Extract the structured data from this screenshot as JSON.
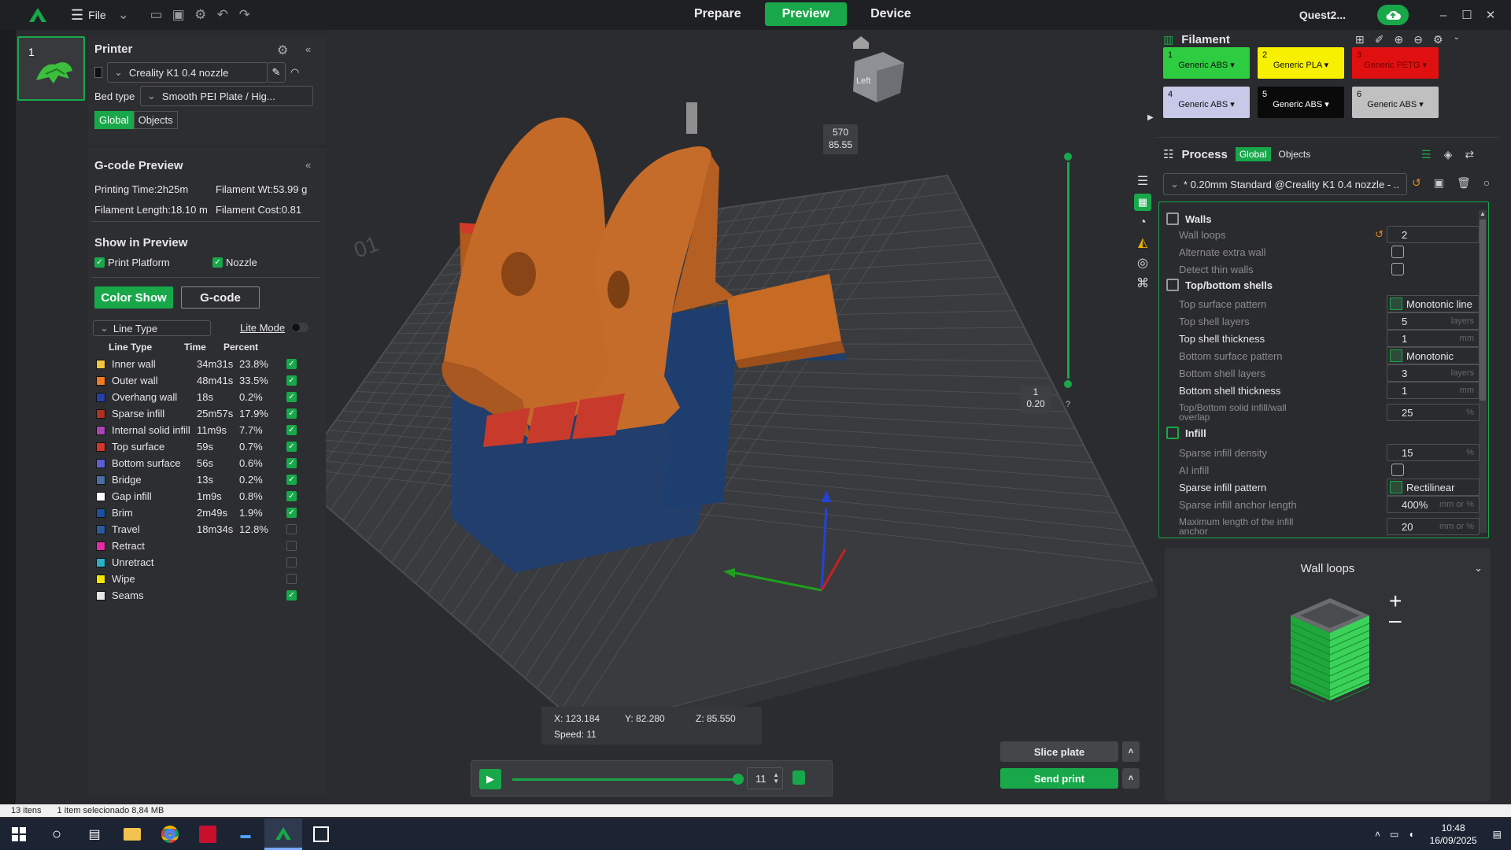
{
  "titlebar": {
    "file_label": "File",
    "tabs": [
      "Prepare",
      "Preview",
      "Device"
    ],
    "printer_name": "Quest2...",
    "accent": "#18a84a"
  },
  "thumbnail": {
    "plate_number": "1"
  },
  "printer": {
    "title": "Printer",
    "printer_select": "Creality K1 0.4 nozzle",
    "bed_type_label": "Bed type",
    "bed_type_select": "Smooth PEI Plate / Hig...",
    "seg_global": "Global",
    "seg_objects": "Objects"
  },
  "gcode_preview": {
    "title": "G-code Preview",
    "printing_time": "Printing Time:2h25m",
    "filament_wt": "Filament Wt:53.99 g",
    "filament_length": "Filament Length:18.10 m",
    "filament_cost": "Filament Cost:0.81",
    "show_title": "Show in Preview",
    "print_platform": "Print Platform",
    "nozzle": "Nozzle",
    "color_show": "Color Show",
    "gcode_btn": "G-code",
    "line_type_select": "Line Type",
    "lite_mode": "Lite Mode",
    "headers": {
      "type": "Line Type",
      "time": "Time",
      "percent": "Percent"
    },
    "rows": [
      {
        "name": "Inner wall",
        "time": "34m31s",
        "pct": "23.8%",
        "color": "#f5c542",
        "checked": true
      },
      {
        "name": "Outer wall",
        "time": "48m41s",
        "pct": "33.5%",
        "color": "#f07b22",
        "checked": true
      },
      {
        "name": "Overhang wall",
        "time": "18s",
        "pct": "0.2%",
        "color": "#2740a8",
        "checked": true
      },
      {
        "name": "Sparse infill",
        "time": "25m57s",
        "pct": "17.9%",
        "color": "#b03020",
        "checked": true
      },
      {
        "name": "Internal solid infill",
        "time": "11m9s",
        "pct": "7.7%",
        "color": "#a845b5",
        "checked": true
      },
      {
        "name": "Top surface",
        "time": "59s",
        "pct": "0.7%",
        "color": "#d0352e",
        "checked": true
      },
      {
        "name": "Bottom surface",
        "time": "56s",
        "pct": "0.6%",
        "color": "#5b5fd0",
        "checked": true
      },
      {
        "name": "Bridge",
        "time": "13s",
        "pct": "0.2%",
        "color": "#4a6fa5",
        "checked": true
      },
      {
        "name": "Gap infill",
        "time": "1m9s",
        "pct": "0.8%",
        "color": "#ffffff",
        "checked": true
      },
      {
        "name": "Brim",
        "time": "2m49s",
        "pct": "1.9%",
        "color": "#1e4f9e",
        "checked": true
      },
      {
        "name": "Travel",
        "time": "18m34s",
        "pct": "12.8%",
        "color": "#2d5b9c",
        "checked": false
      },
      {
        "name": "Retract",
        "time": "",
        "pct": "",
        "color": "#e52aa8",
        "checked": false
      },
      {
        "name": "Unretract",
        "time": "",
        "pct": "",
        "color": "#2ab0c8",
        "checked": false
      },
      {
        "name": "Wipe",
        "time": "",
        "pct": "",
        "color": "#f2e600",
        "checked": false
      },
      {
        "name": "Seams",
        "time": "",
        "pct": "",
        "color": "#e6e6e6",
        "checked": true
      }
    ]
  },
  "viewport": {
    "view_cube_label": "Left",
    "layer_top": "570",
    "height_top": "85.55",
    "layer_bottom": "1",
    "height_bottom": "0.20",
    "help": "?",
    "plate_label": "01",
    "coords": {
      "x": "X: 123.184",
      "y": "Y: 82.280",
      "z": "Z: 85.550",
      "speed": "Speed: 11"
    },
    "move_value": "11",
    "slice_plate": "Slice plate",
    "send_print": "Send print"
  },
  "filament": {
    "title": "Filament",
    "items": [
      {
        "num": "1",
        "name": "Generic ABS",
        "color": "#2ecc40",
        "text": "#111"
      },
      {
        "num": "2",
        "name": "Generic PLA",
        "color": "#f7f000",
        "text": "#111"
      },
      {
        "num": "3",
        "name": "Generic PETG",
        "color": "#e01010",
        "text": "#6a0000"
      },
      {
        "num": "4",
        "name": "Generic ABS",
        "color": "#c8c8e8",
        "text": "#111"
      },
      {
        "num": "5",
        "name": "Generic ABS",
        "color": "#0a0a0a",
        "text": "#fff"
      },
      {
        "num": "6",
        "name": "Generic ABS",
        "color": "#c0c0c0",
        "text": "#111"
      }
    ]
  },
  "process": {
    "title": "Process",
    "seg_global": "Global",
    "seg_objects": "Objects",
    "preset": "* 0.20mm Standard @Creality K1 0.4 nozzle - ...",
    "walls": "Walls",
    "wall_loops_label": "Wall loops",
    "wall_loops": "2",
    "alternate_extra_wall": "Alternate extra wall",
    "detect_thin_walls": "Detect thin walls",
    "top_bottom": "Top/bottom shells",
    "top_surface_pattern_label": "Top surface pattern",
    "top_surface_pattern": "Monotonic line",
    "top_shell_layers_label": "Top shell layers",
    "top_shell_layers": "5",
    "top_shell_thickness_label": "Top shell thickness",
    "top_shell_thickness": "1",
    "bottom_surface_pattern_label": "Bottom surface pattern",
    "bottom_surface_pattern": "Monotonic",
    "bottom_shell_layers_label": "Bottom shell layers",
    "bottom_shell_layers": "3",
    "bottom_shell_thickness_label": "Bottom shell thickness",
    "bottom_shell_thickness": "1",
    "overlap_label_1": "Top/Bottom solid infill/wall",
    "overlap_label_2": "overlap",
    "overlap": "25",
    "infill": "Infill",
    "sparse_density_label": "Sparse infill density",
    "sparse_density": "15",
    "ai_infill": "AI infill",
    "sparse_pattern_label": "Sparse infill pattern",
    "sparse_pattern": "Rectilinear",
    "anchor_label": "Sparse infill anchor length",
    "anchor": "400%",
    "max_anchor_label_1": "Maximum length of the infill",
    "max_anchor_label_2": "anchor",
    "max_anchor": "20",
    "unit_layers": "layers",
    "unit_mm": "mm",
    "unit_pct": "%",
    "unit_mm_or_pct": "mm or %"
  },
  "wall_help": {
    "title": "Wall loops"
  },
  "statusbar": {
    "items": "13 itens",
    "selected": "1 item selecionado  8,84 MB"
  },
  "taskbar": {
    "time": "10:48",
    "date": "16/09/2025"
  }
}
